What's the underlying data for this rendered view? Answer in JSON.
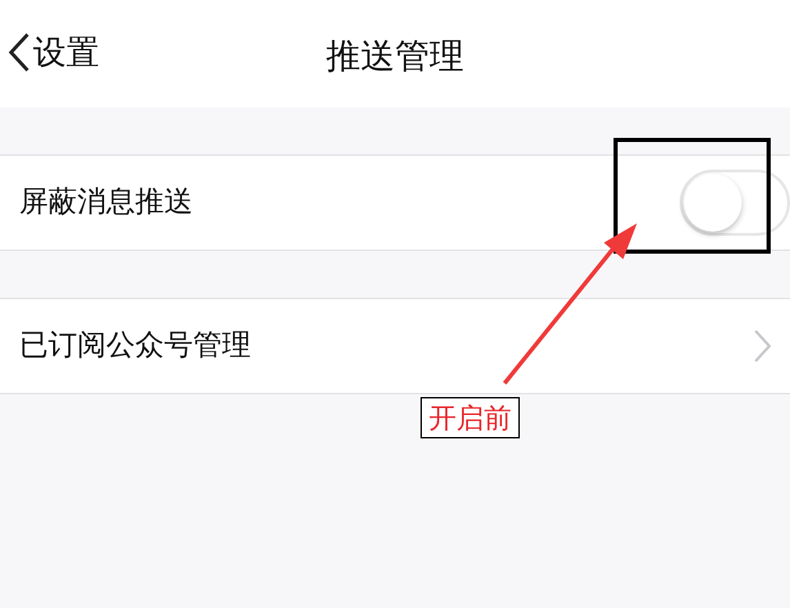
{
  "nav": {
    "back_label": "设置",
    "title": "推送管理"
  },
  "rows": [
    {
      "kind": "switch",
      "label": "屏蔽消息推送",
      "on": false
    },
    {
      "kind": "link",
      "label": "已订阅公众号管理"
    }
  ],
  "annotation": {
    "label": "开启前"
  }
}
